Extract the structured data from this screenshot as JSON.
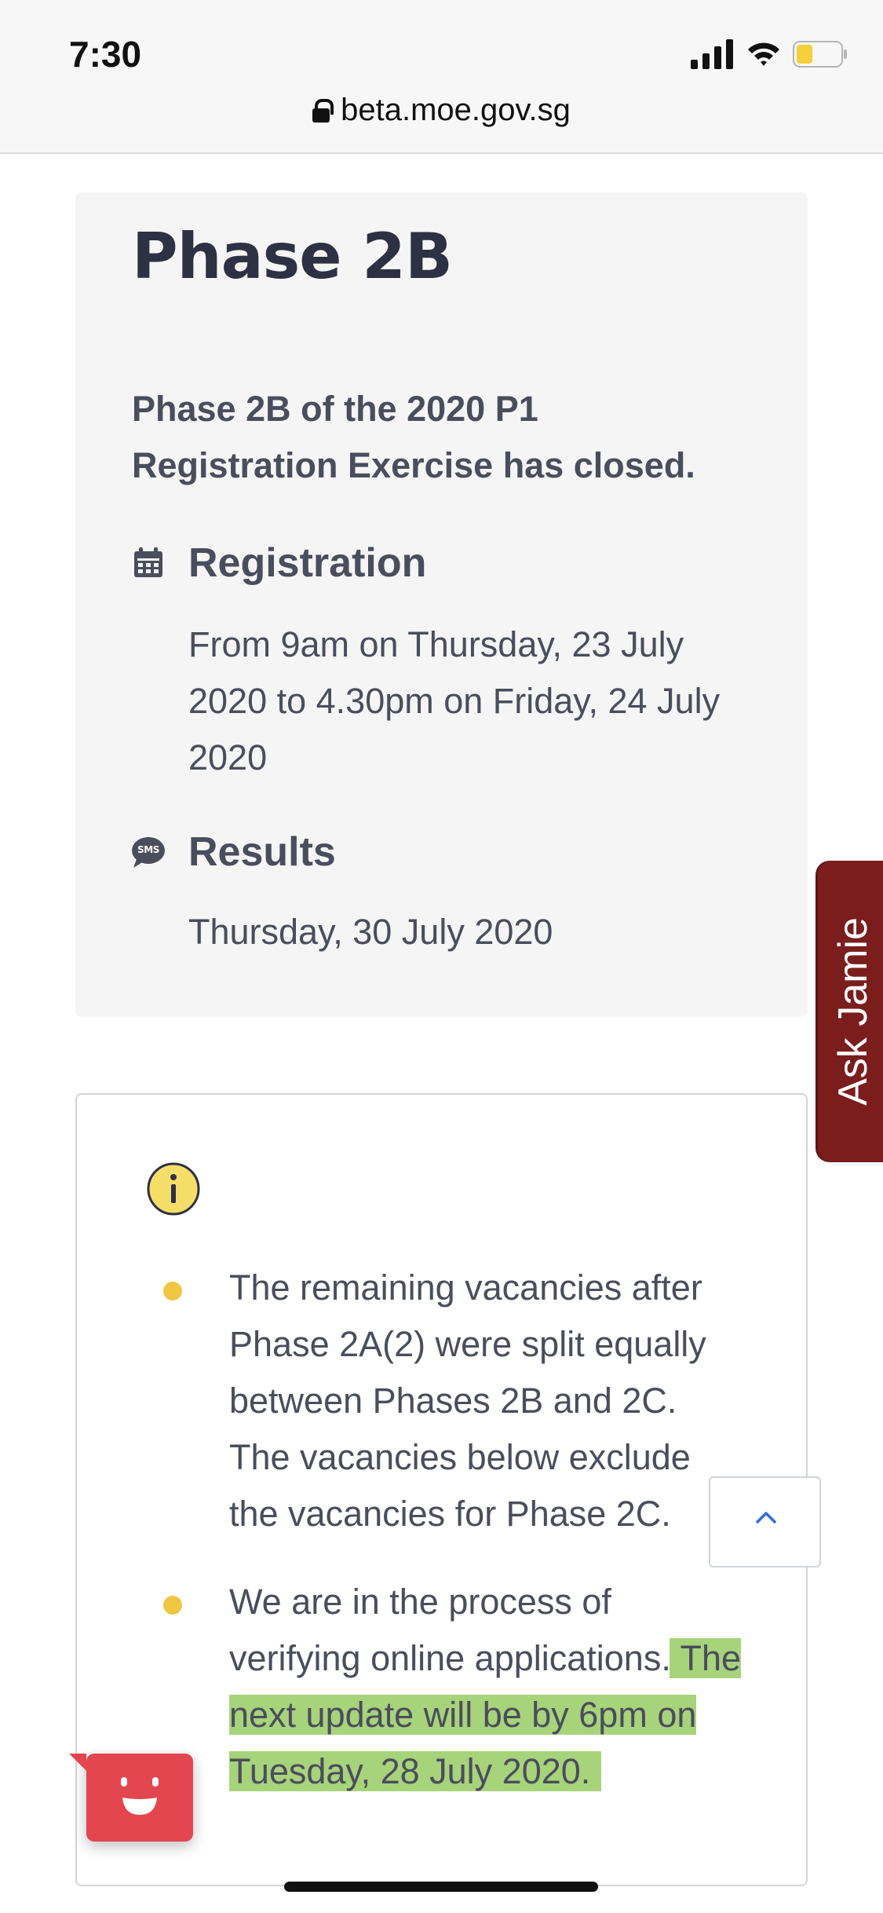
{
  "status_bar": {
    "time": "7:30",
    "url": "beta.moe.gov.sg"
  },
  "phase": {
    "title": "Phase 2B",
    "description": "Phase 2B of the 2020 P1 Registration Exercise has closed.",
    "registration": {
      "icon": "calendar-icon",
      "heading": "Registration",
      "text": "From 9am on Thursday, 23 July 2020 to 4.30pm on Friday, 24 July 2020"
    },
    "results": {
      "icon": "sms-icon",
      "icon_text": "SMS",
      "heading": "Results",
      "text": "Thursday, 30 July 2020"
    }
  },
  "info": {
    "icon": "info-icon",
    "bullets": [
      {
        "text": "The remaining vacancies after Phase 2A(2) were split equally between Phases 2B and 2C. The vacancies below exclude the vacancies for Phase 2C."
      },
      {
        "text": "We are in the process of verifying online applications.",
        "highlighted": "The next update will be by 6pm on Tuesday, 28 July 2020."
      }
    ]
  },
  "ask_jamie": {
    "label": "Ask Jamie"
  },
  "colors": {
    "title": "#2e3043",
    "body_text": "#4a4d5c",
    "bullet": "#f0c642",
    "highlight": "#a7d37a",
    "ask_jamie_bg": "#7b1d1d",
    "chat_bot_bg": "#e4464f",
    "back_top_arrow": "#2f6fd6"
  }
}
